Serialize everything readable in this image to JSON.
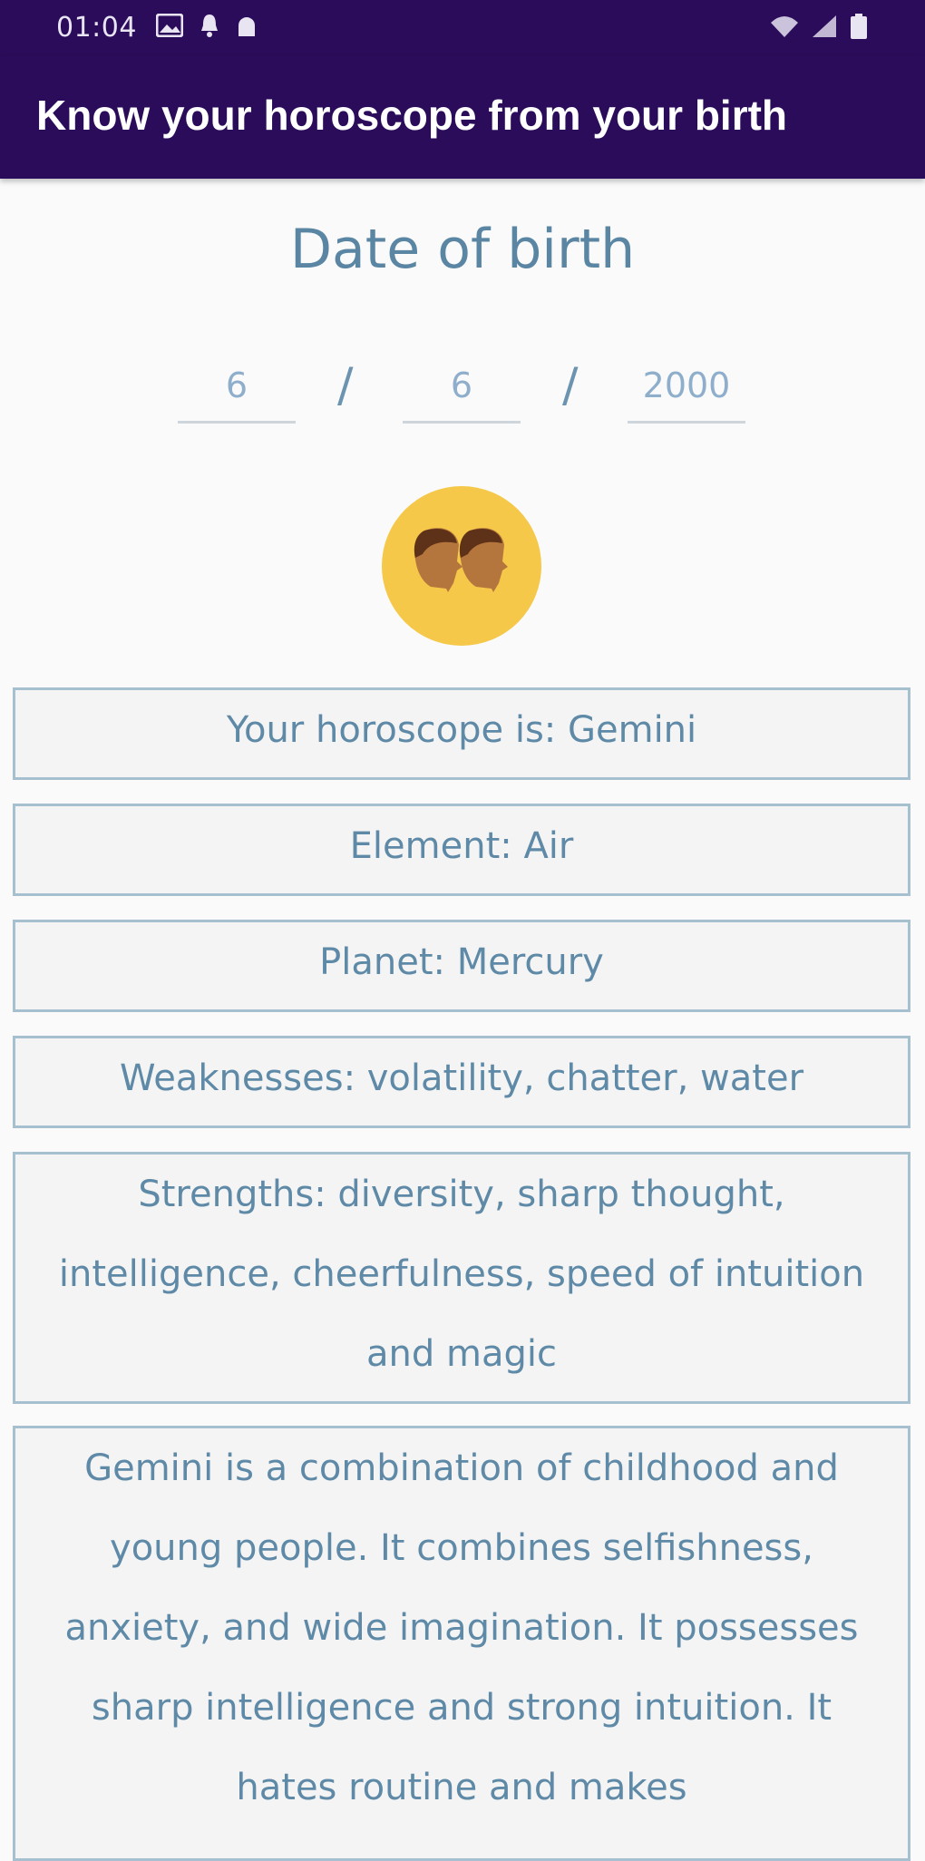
{
  "status_bar": {
    "time": "01:04",
    "left_icons": [
      "image-icon",
      "notification-icon",
      "android-icon"
    ],
    "right_icons": [
      "wifi-icon",
      "signal-icon",
      "battery-icon"
    ]
  },
  "app_bar": {
    "title": "Know your horoscope from your birth"
  },
  "dob": {
    "heading": "Date of birth",
    "day": "6",
    "month": "6",
    "year": "2000",
    "separator": "/"
  },
  "sign": {
    "icon": "gemini-twins-icon"
  },
  "results": {
    "horoscope": "Your horoscope is: Gemini",
    "element": "Element: Air",
    "planet": "Planet: Mercury",
    "weaknesses": "Weaknesses: volatility, chatter, water",
    "strengths": "Strengths: diversity, sharp thought, intelligence, cheerfulness, speed of intuition and magic",
    "description": "Gemini is a combination of childhood and young people. It combines selfishness, anxiety, and wide imagination. It possesses sharp intelligence and strong intuition. It hates routine and makes"
  },
  "colors": {
    "app_bar": "#2a0c5a",
    "accent_text": "#5f8aa7",
    "box_border": "#a7c0cf",
    "avatar_bg": "#f5c84a"
  }
}
